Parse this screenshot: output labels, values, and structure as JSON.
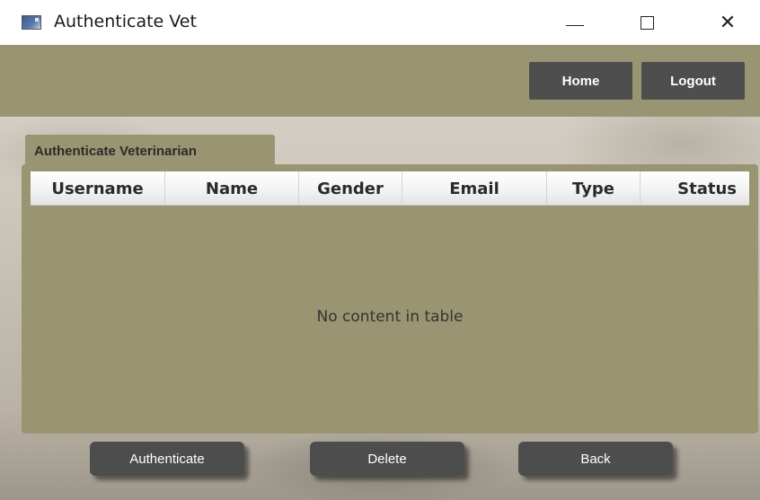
{
  "window": {
    "title": "Authenticate Vet",
    "minimize_icon": "minimize-icon",
    "maximize_icon": "maximize-icon",
    "close_icon": "close-icon",
    "close_glyph": "✕"
  },
  "header": {
    "home_label": "Home",
    "logout_label": "Logout",
    "color": "#999572"
  },
  "tab": {
    "label": "Authenticate Veterinarian"
  },
  "table": {
    "columns": [
      "Username",
      "Name",
      "Gender",
      "Email",
      "Type",
      "Status"
    ],
    "rows": [],
    "empty_text": "No content in table"
  },
  "actions": {
    "authenticate_label": "Authenticate",
    "delete_label": "Delete",
    "back_label": "Back"
  },
  "colors": {
    "panel": "#999572",
    "button": "#4e4e4e",
    "button_text": "#ffffff"
  }
}
